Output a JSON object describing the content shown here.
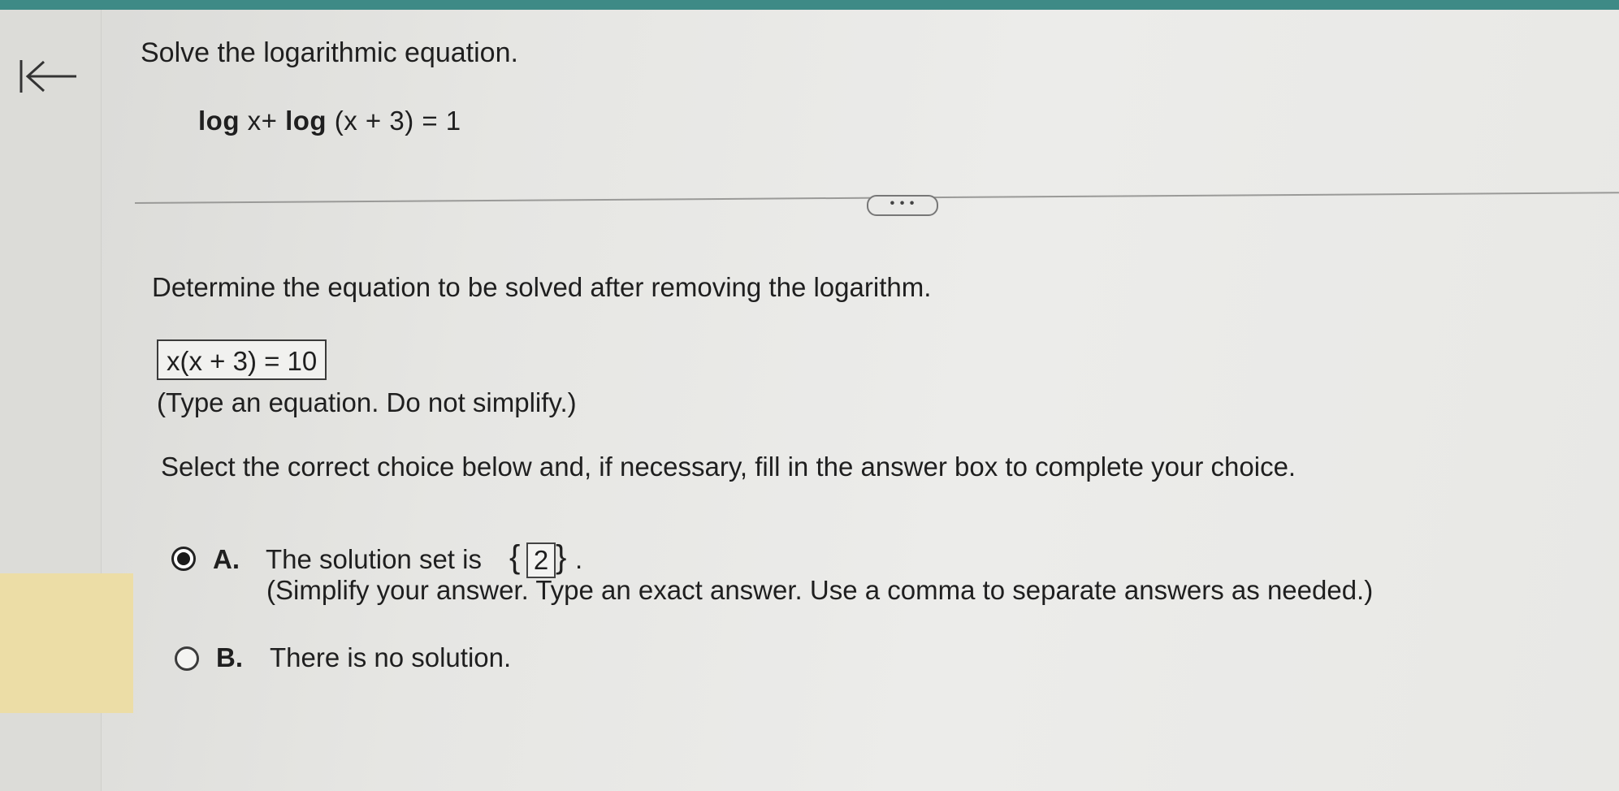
{
  "problem": {
    "title": "Solve the logarithmic equation.",
    "equation": {
      "log1": "log",
      "arg1": " x+ ",
      "log2": "log",
      "arg2": " (x + 3) = 1"
    }
  },
  "more_button": {
    "label": "• • •"
  },
  "step": {
    "instruction": "Determine the equation to be solved after removing the logarithm.",
    "answer": "x(x + 3) = 10",
    "hint": "(Type an equation. Do not simplify.)"
  },
  "choice_prompt": "Select the correct choice below and, if necessary, fill in the answer box to complete your choice.",
  "choices": [
    {
      "letter": "A.",
      "text": "The solution set is",
      "brace_open": "{",
      "value": "2",
      "brace_close": "}",
      "period": ".",
      "hint": "(Simplify your answer. Type an exact answer. Use a comma to separate answers as needed.)",
      "selected": true
    },
    {
      "letter": "B.",
      "text": "There is no solution.",
      "selected": false
    }
  ],
  "colors": {
    "top_bar": "#3e8a86",
    "highlight": "#ecdda6"
  },
  "icons": {
    "back": "arrow-left-to-bar-icon"
  }
}
